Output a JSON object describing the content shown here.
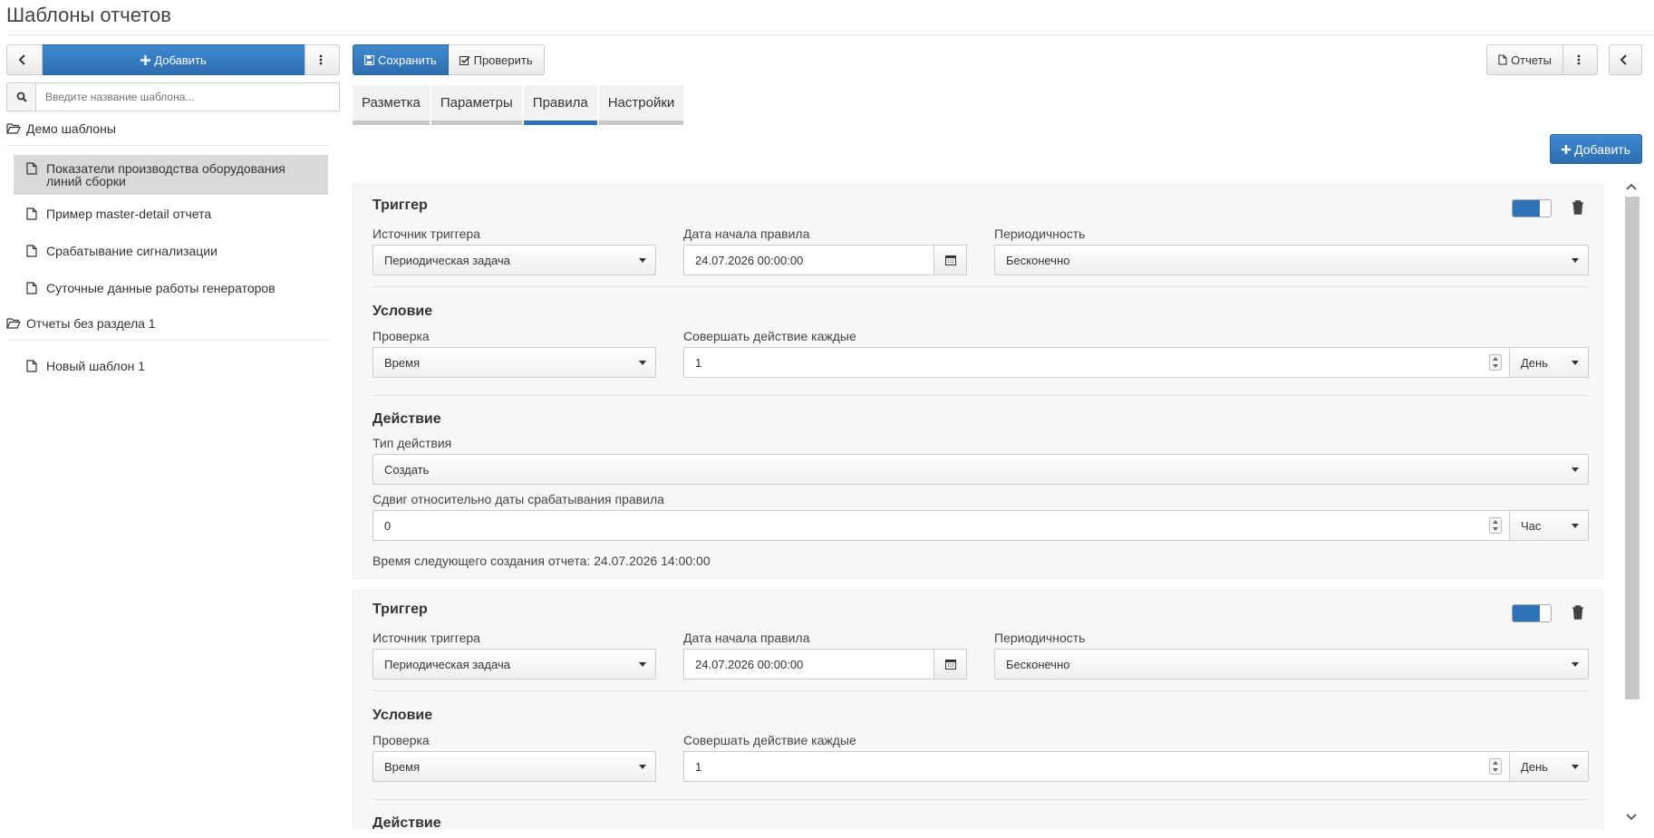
{
  "page": {
    "title": "Шаблоны отчетов"
  },
  "left": {
    "add_label": "Добавить",
    "search_placeholder": "Введите название шаблона...",
    "groups": [
      {
        "label": "Демо шаблоны",
        "items": [
          "Показатели производства оборудования линий сборки",
          "Пример master-detail отчета",
          "Срабатывание сигнализации",
          "Суточные данные работы генераторов"
        ]
      },
      {
        "label": "Отчеты без раздела 1",
        "items": [
          "Новый шаблон 1"
        ]
      }
    ]
  },
  "toolbar": {
    "save_label": "Сохранить",
    "check_label": "Проверить",
    "reports_label": "Отчеты"
  },
  "tabs": [
    "Разметка",
    "Параметры",
    "Правила",
    "Настройки"
  ],
  "active_tab": "Правила",
  "add_rule_label": "Добавить",
  "rules": [
    {
      "trigger_title": "Триггер",
      "enabled": true,
      "source_label": "Источник триггера",
      "source_value": "Периодическая задача",
      "start_label": "Дата начала правила",
      "start_value": "24.07.2026 00:00:00",
      "period_label": "Периодичность",
      "period_value": "Бесконечно",
      "condition_title": "Условие",
      "check_label": "Проверка",
      "check_value": "Время",
      "every_label": "Совершать действие каждые",
      "every_value": "1",
      "every_unit": "День",
      "action_title": "Действие",
      "action_type_label": "Тип действия",
      "action_type_value": "Создать",
      "shift_label": "Сдвиг относительно даты срабатывания правила",
      "shift_value": "0",
      "shift_unit": "Час",
      "next_time": "Время следующего создания отчета: 24.07.2026 14:00:00"
    },
    {
      "trigger_title": "Триггер",
      "enabled": true,
      "source_label": "Источник триггера",
      "source_value": "Периодическая задача",
      "start_label": "Дата начала правила",
      "start_value": "24.07.2026 00:00:00",
      "period_label": "Периодичность",
      "period_value": "Бесконечно",
      "condition_title": "Условие",
      "check_label": "Проверка",
      "check_value": "Время",
      "every_label": "Совершать действие каждые",
      "every_value": "1",
      "every_unit": "День",
      "action_title": "Действие"
    }
  ],
  "colors": {
    "accent": "#2e72b8",
    "active_item": "#d9d9d9"
  }
}
